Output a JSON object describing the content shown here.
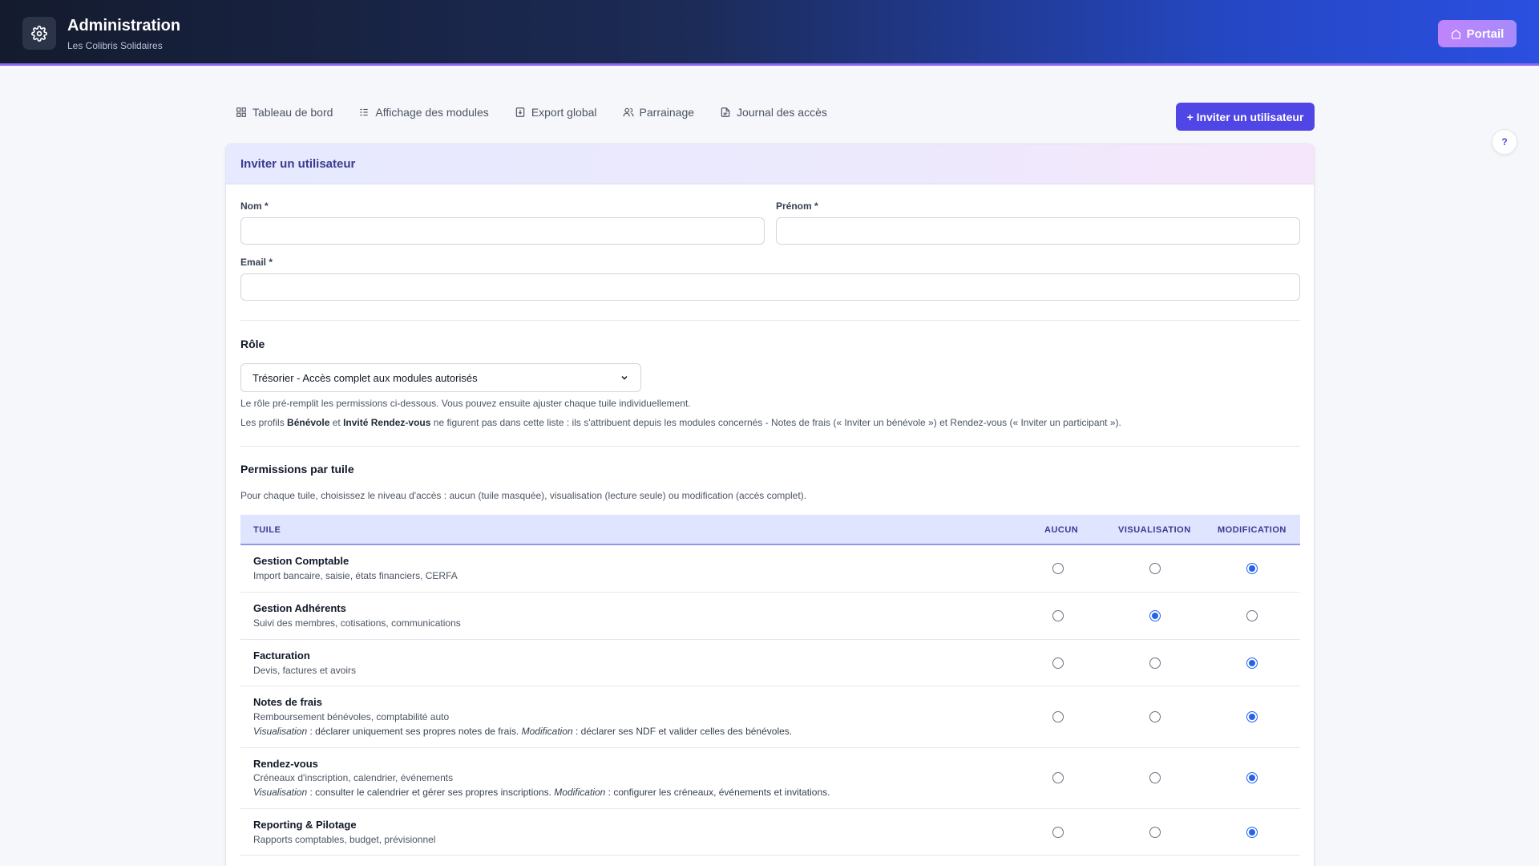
{
  "header": {
    "title": "Administration",
    "subtitle": "Les Colibris Solidaires",
    "portal_label": "Portail"
  },
  "nav": [
    {
      "label": "Tableau de bord",
      "icon": "dashboard-icon"
    },
    {
      "label": "Affichage des modules",
      "icon": "list-icon"
    },
    {
      "label": "Export global",
      "icon": "export-icon"
    },
    {
      "label": "Parrainage",
      "icon": "users-icon"
    },
    {
      "label": "Journal des accès",
      "icon": "document-icon"
    }
  ],
  "invite_button": "+ Inviter un utilisateur",
  "help_label": "?",
  "form": {
    "title": "Inviter un utilisateur",
    "nom_label": "Nom *",
    "nom_value": "",
    "prenom_label": "Prénom *",
    "prenom_value": "",
    "email_label": "Email *",
    "email_value": "",
    "role_title": "Rôle",
    "role_selected": "Trésorier - Accès complet aux modules autorisés",
    "role_hint1": "Le rôle pré-remplit les permissions ci-dessous. Vous pouvez ensuite ajuster chaque tuile individuellement.",
    "role_hint2_a": "Les profils ",
    "role_hint2_b": "Bénévole",
    "role_hint2_c": " et ",
    "role_hint2_d": "Invité Rendez-vous",
    "role_hint2_e": " ne figurent pas dans cette liste : ils s'attribuent depuis les modules concernés - Notes de frais (« Inviter un bénévole ») et Rendez-vous (« Inviter un participant »).",
    "perm_title": "Permissions par tuile",
    "perm_hint": "Pour chaque tuile, choisissez le niveau d'accès : aucun (tuile masquée), visualisation (lecture seule) ou modification (accès complet)."
  },
  "table": {
    "headers": {
      "tile": "TUILE",
      "none": "AUCUN",
      "view": "VISUALISATION",
      "edit": "MODIFICATION"
    },
    "rows": [
      {
        "name": "Gestion Comptable",
        "desc": "Import bancaire, saisie, états financiers, CERFA",
        "level": "edit"
      },
      {
        "name": "Gestion Adhérents",
        "desc": "Suivi des membres, cotisations, communications",
        "level": "view"
      },
      {
        "name": "Facturation",
        "desc": "Devis, factures et avoirs",
        "level": "edit"
      },
      {
        "name": "Notes de frais",
        "desc": "Remboursement bénévoles, comptabilité auto",
        "level": "edit",
        "note_v": "Visualisation",
        "note_v_text": " : déclarer uniquement ses propres notes de frais. ",
        "note_m": "Modification",
        "note_m_text": " : déclarer ses NDF et valider celles des bénévoles."
      },
      {
        "name": "Rendez-vous",
        "desc": "Créneaux d'inscription, calendrier, événements",
        "level": "edit",
        "note_v": "Visualisation",
        "note_v_text": " : consulter le calendrier et gérer ses propres inscriptions. ",
        "note_m": "Modification",
        "note_m_text": " : configurer les créneaux, événements et invitations."
      },
      {
        "name": "Reporting & Pilotage",
        "desc": "Rapports comptables, budget, prévisionnel",
        "level": "edit"
      }
    ]
  }
}
